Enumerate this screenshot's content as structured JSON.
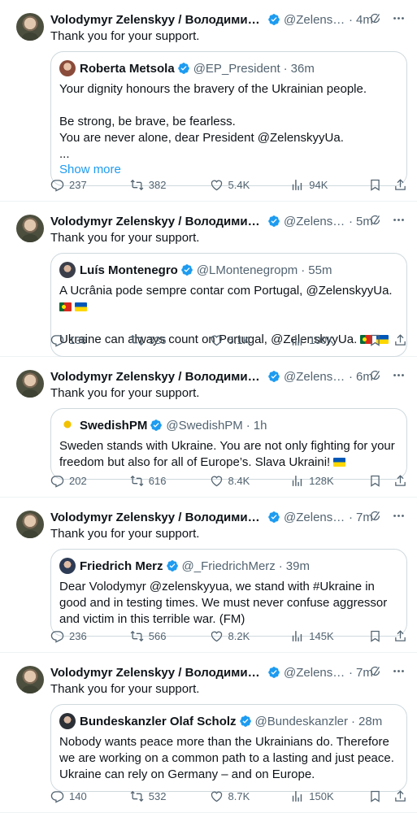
{
  "colors": {
    "accent": "#1d9bf0",
    "muted": "#536471",
    "verified": "#1d9bf0",
    "border": "#cfd9de"
  },
  "posts": [
    {
      "author": "Volodymyr Zelenskyy / Володимир Зеленський",
      "handle": "@ZelenskyyUa",
      "time": "4m",
      "text": "Thank you for your support.",
      "quote": {
        "author": "Roberta Metsola",
        "handle": "@EP_President",
        "time": "36m",
        "text": "Your dignity honours the bravery of the Ukrainian people.\n\nBe strong, be brave, be fearless.\nYou are never alone, dear President @ZelenskyyUa.\n...",
        "show_more": "Show more"
      },
      "stats": {
        "replies": "237",
        "reposts": "382",
        "likes": "5.4K",
        "views": "94K"
      }
    },
    {
      "author": "Volodymyr Zelenskyy / Володимир Зеленський",
      "handle": "@ZelenskyyUa",
      "time": "5m",
      "text": "Thank you for your support.",
      "quote": {
        "author": "Luís Montenegro",
        "handle": "@LMontenegropm",
        "time": "55m",
        "line1": "A Ucrânia pode sempre contar com Portugal, @ZelenskyyUa.",
        "line2": "Ukraine can always count on Portugal, @ZelenskyyUa."
      },
      "stats": {
        "replies": "136",
        "reposts": "326",
        "likes": "5.1K",
        "views": "100K"
      }
    },
    {
      "author": "Volodymyr Zelenskyy / Володимир Зеленський",
      "handle": "@ZelenskyyUa",
      "time": "6m",
      "text": "Thank you for your support.",
      "quote": {
        "author": "SwedishPM",
        "handle": "@SwedishPM",
        "time": "1h",
        "text": "Sweden stands with Ukraine. You are not only fighting for your freedom but also for all of Europe’s. Slava Ukraini!"
      },
      "stats": {
        "replies": "202",
        "reposts": "616",
        "likes": "8.4K",
        "views": "128K"
      }
    },
    {
      "author": "Volodymyr Zelenskyy / Володимир Зеленський",
      "handle": "@ZelenskyyUa",
      "time": "7m",
      "text": "Thank you for your support.",
      "quote": {
        "author": "Friedrich Merz",
        "handle": "@_FriedrichMerz",
        "time": "39m",
        "text": "Dear Volodymyr @zelenskyyua, we stand with #Ukraine in good and in testing times. We must never confuse aggressor and victim in this terrible war. (FM)"
      },
      "stats": {
        "replies": "236",
        "reposts": "566",
        "likes": "8.2K",
        "views": "145K"
      }
    },
    {
      "author": "Volodymyr Zelenskyy / Володимир Зеленський",
      "handle": "@ZelenskyyUa",
      "time": "7m",
      "text": "Thank you for your support.",
      "quote": {
        "author": "Bundeskanzler Olaf Scholz",
        "handle": "@Bundeskanzler",
        "time": "28m",
        "text": "Nobody wants peace more than the Ukrainians do. Therefore we are working on a common path to a lasting and just peace. Ukraine can rely on Germany – and on Europe."
      },
      "stats": {
        "replies": "140",
        "reposts": "532",
        "likes": "8.7K",
        "views": "150K"
      }
    }
  ]
}
